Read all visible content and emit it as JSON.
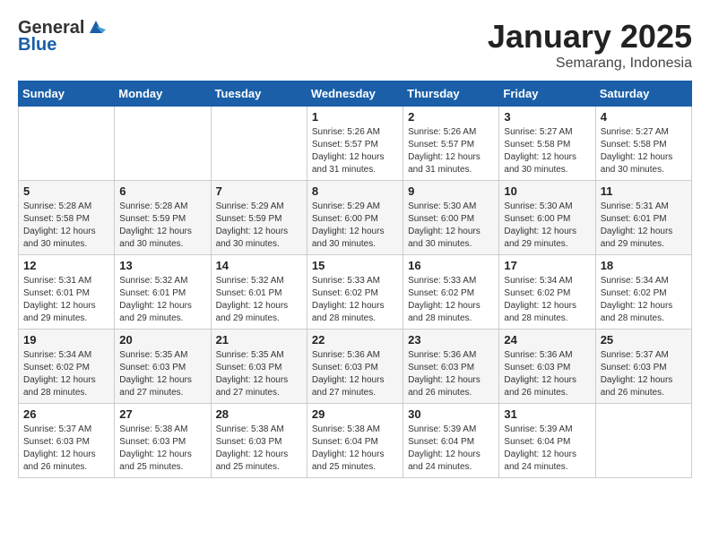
{
  "header": {
    "logo_line1": "General",
    "logo_line2": "Blue",
    "title": "January 2025",
    "subtitle": "Semarang, Indonesia"
  },
  "weekdays": [
    "Sunday",
    "Monday",
    "Tuesday",
    "Wednesday",
    "Thursday",
    "Friday",
    "Saturday"
  ],
  "weeks": [
    [
      {
        "day": "",
        "sunrise": "",
        "sunset": "",
        "daylight": ""
      },
      {
        "day": "",
        "sunrise": "",
        "sunset": "",
        "daylight": ""
      },
      {
        "day": "",
        "sunrise": "",
        "sunset": "",
        "daylight": ""
      },
      {
        "day": "1",
        "sunrise": "Sunrise: 5:26 AM",
        "sunset": "Sunset: 5:57 PM",
        "daylight": "Daylight: 12 hours and 31 minutes."
      },
      {
        "day": "2",
        "sunrise": "Sunrise: 5:26 AM",
        "sunset": "Sunset: 5:57 PM",
        "daylight": "Daylight: 12 hours and 31 minutes."
      },
      {
        "day": "3",
        "sunrise": "Sunrise: 5:27 AM",
        "sunset": "Sunset: 5:58 PM",
        "daylight": "Daylight: 12 hours and 30 minutes."
      },
      {
        "day": "4",
        "sunrise": "Sunrise: 5:27 AM",
        "sunset": "Sunset: 5:58 PM",
        "daylight": "Daylight: 12 hours and 30 minutes."
      }
    ],
    [
      {
        "day": "5",
        "sunrise": "Sunrise: 5:28 AM",
        "sunset": "Sunset: 5:58 PM",
        "daylight": "Daylight: 12 hours and 30 minutes."
      },
      {
        "day": "6",
        "sunrise": "Sunrise: 5:28 AM",
        "sunset": "Sunset: 5:59 PM",
        "daylight": "Daylight: 12 hours and 30 minutes."
      },
      {
        "day": "7",
        "sunrise": "Sunrise: 5:29 AM",
        "sunset": "Sunset: 5:59 PM",
        "daylight": "Daylight: 12 hours and 30 minutes."
      },
      {
        "day": "8",
        "sunrise": "Sunrise: 5:29 AM",
        "sunset": "Sunset: 6:00 PM",
        "daylight": "Daylight: 12 hours and 30 minutes."
      },
      {
        "day": "9",
        "sunrise": "Sunrise: 5:30 AM",
        "sunset": "Sunset: 6:00 PM",
        "daylight": "Daylight: 12 hours and 30 minutes."
      },
      {
        "day": "10",
        "sunrise": "Sunrise: 5:30 AM",
        "sunset": "Sunset: 6:00 PM",
        "daylight": "Daylight: 12 hours and 29 minutes."
      },
      {
        "day": "11",
        "sunrise": "Sunrise: 5:31 AM",
        "sunset": "Sunset: 6:01 PM",
        "daylight": "Daylight: 12 hours and 29 minutes."
      }
    ],
    [
      {
        "day": "12",
        "sunrise": "Sunrise: 5:31 AM",
        "sunset": "Sunset: 6:01 PM",
        "daylight": "Daylight: 12 hours and 29 minutes."
      },
      {
        "day": "13",
        "sunrise": "Sunrise: 5:32 AM",
        "sunset": "Sunset: 6:01 PM",
        "daylight": "Daylight: 12 hours and 29 minutes."
      },
      {
        "day": "14",
        "sunrise": "Sunrise: 5:32 AM",
        "sunset": "Sunset: 6:01 PM",
        "daylight": "Daylight: 12 hours and 29 minutes."
      },
      {
        "day": "15",
        "sunrise": "Sunrise: 5:33 AM",
        "sunset": "Sunset: 6:02 PM",
        "daylight": "Daylight: 12 hours and 28 minutes."
      },
      {
        "day": "16",
        "sunrise": "Sunrise: 5:33 AM",
        "sunset": "Sunset: 6:02 PM",
        "daylight": "Daylight: 12 hours and 28 minutes."
      },
      {
        "day": "17",
        "sunrise": "Sunrise: 5:34 AM",
        "sunset": "Sunset: 6:02 PM",
        "daylight": "Daylight: 12 hours and 28 minutes."
      },
      {
        "day": "18",
        "sunrise": "Sunrise: 5:34 AM",
        "sunset": "Sunset: 6:02 PM",
        "daylight": "Daylight: 12 hours and 28 minutes."
      }
    ],
    [
      {
        "day": "19",
        "sunrise": "Sunrise: 5:34 AM",
        "sunset": "Sunset: 6:02 PM",
        "daylight": "Daylight: 12 hours and 28 minutes."
      },
      {
        "day": "20",
        "sunrise": "Sunrise: 5:35 AM",
        "sunset": "Sunset: 6:03 PM",
        "daylight": "Daylight: 12 hours and 27 minutes."
      },
      {
        "day": "21",
        "sunrise": "Sunrise: 5:35 AM",
        "sunset": "Sunset: 6:03 PM",
        "daylight": "Daylight: 12 hours and 27 minutes."
      },
      {
        "day": "22",
        "sunrise": "Sunrise: 5:36 AM",
        "sunset": "Sunset: 6:03 PM",
        "daylight": "Daylight: 12 hours and 27 minutes."
      },
      {
        "day": "23",
        "sunrise": "Sunrise: 5:36 AM",
        "sunset": "Sunset: 6:03 PM",
        "daylight": "Daylight: 12 hours and 26 minutes."
      },
      {
        "day": "24",
        "sunrise": "Sunrise: 5:36 AM",
        "sunset": "Sunset: 6:03 PM",
        "daylight": "Daylight: 12 hours and 26 minutes."
      },
      {
        "day": "25",
        "sunrise": "Sunrise: 5:37 AM",
        "sunset": "Sunset: 6:03 PM",
        "daylight": "Daylight: 12 hours and 26 minutes."
      }
    ],
    [
      {
        "day": "26",
        "sunrise": "Sunrise: 5:37 AM",
        "sunset": "Sunset: 6:03 PM",
        "daylight": "Daylight: 12 hours and 26 minutes."
      },
      {
        "day": "27",
        "sunrise": "Sunrise: 5:38 AM",
        "sunset": "Sunset: 6:03 PM",
        "daylight": "Daylight: 12 hours and 25 minutes."
      },
      {
        "day": "28",
        "sunrise": "Sunrise: 5:38 AM",
        "sunset": "Sunset: 6:03 PM",
        "daylight": "Daylight: 12 hours and 25 minutes."
      },
      {
        "day": "29",
        "sunrise": "Sunrise: 5:38 AM",
        "sunset": "Sunset: 6:04 PM",
        "daylight": "Daylight: 12 hours and 25 minutes."
      },
      {
        "day": "30",
        "sunrise": "Sunrise: 5:39 AM",
        "sunset": "Sunset: 6:04 PM",
        "daylight": "Daylight: 12 hours and 24 minutes."
      },
      {
        "day": "31",
        "sunrise": "Sunrise: 5:39 AM",
        "sunset": "Sunset: 6:04 PM",
        "daylight": "Daylight: 12 hours and 24 minutes."
      },
      {
        "day": "",
        "sunrise": "",
        "sunset": "",
        "daylight": ""
      }
    ]
  ]
}
